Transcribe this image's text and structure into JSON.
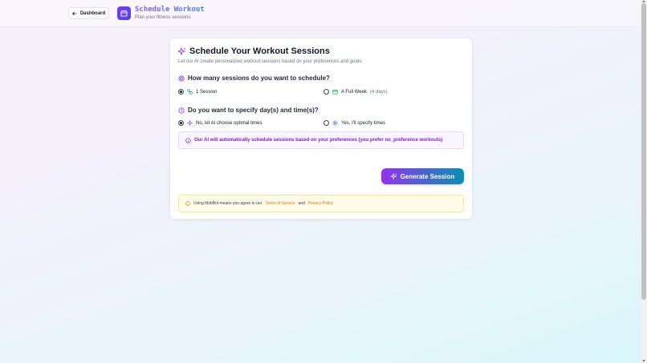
{
  "header": {
    "back_label": "Dashboard",
    "app_title": "Schedule Workout",
    "app_subtitle": "Plan your fitness sessions"
  },
  "card": {
    "title": "Schedule Your Workout Sessions",
    "description": "Let our AI create personalized workout sessions based on your preferences and goals.",
    "question_sessions": "How many sessions do you want to schedule?",
    "option_one": "1 Session",
    "option_week": "A Full Week",
    "option_week_note": "(4 days)",
    "question_times": "Do you want to specify day(s) and time(s)?",
    "option_ai_times": "No, let AI choose optimal times",
    "option_specify_times": "Yes, I'll specify times",
    "info_text": "Our AI will automatically schedule sessions based on your preferences (you prefer no_preference workouts)",
    "generate_label": "Generate Session",
    "terms_prefix": "Using MotiBot means you agree to our",
    "terms_link": "Terms of Service",
    "terms_and": "and",
    "privacy_link": "Privacy Policy"
  },
  "colors": {
    "accent_purple": "#7c3aed",
    "accent_teal": "#0891b2",
    "info_purple": "#7e22ce",
    "terms_link": "#d97706"
  },
  "icons": {
    "back": "arrow-left-icon",
    "app": "calendar-icon",
    "title": "sparkles-icon",
    "sessions_question": "target-icon",
    "times_question": "clock-icon"
  }
}
